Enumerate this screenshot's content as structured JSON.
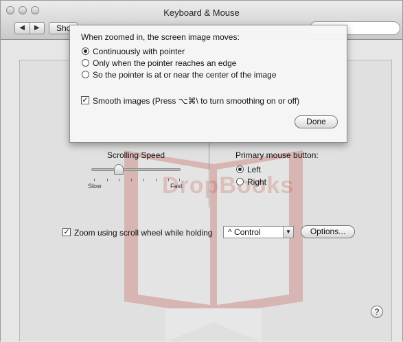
{
  "window": {
    "title": "Keyboard & Mouse",
    "nav_back": "◀",
    "nav_forward": "▶",
    "show_all": "Sho"
  },
  "sheet": {
    "question": "When zoomed in, the screen image moves:",
    "options": [
      {
        "label": "Continuously with pointer",
        "selected": true
      },
      {
        "label": "Only when the pointer reaches an edge",
        "selected": false
      },
      {
        "label": "So the pointer is at or near the center of the image",
        "selected": false
      }
    ],
    "smooth_label": "Smooth images (Press ⌥⌘\\ to turn smoothing on or off)",
    "smooth_checked": true,
    "done_label": "Done"
  },
  "scrolling": {
    "label": "Scrolling Speed",
    "slow": "Slow",
    "fast": "Fast",
    "level": 0.3
  },
  "primary_button": {
    "label": "Primary mouse button:",
    "left": "Left",
    "right": "Right",
    "selected": "Left"
  },
  "zoom": {
    "label": "Zoom using scroll wheel while holding",
    "checked": true,
    "modifier": "^ Control",
    "options_label": "Options..."
  },
  "help": "?",
  "watermark": "DropBooks"
}
